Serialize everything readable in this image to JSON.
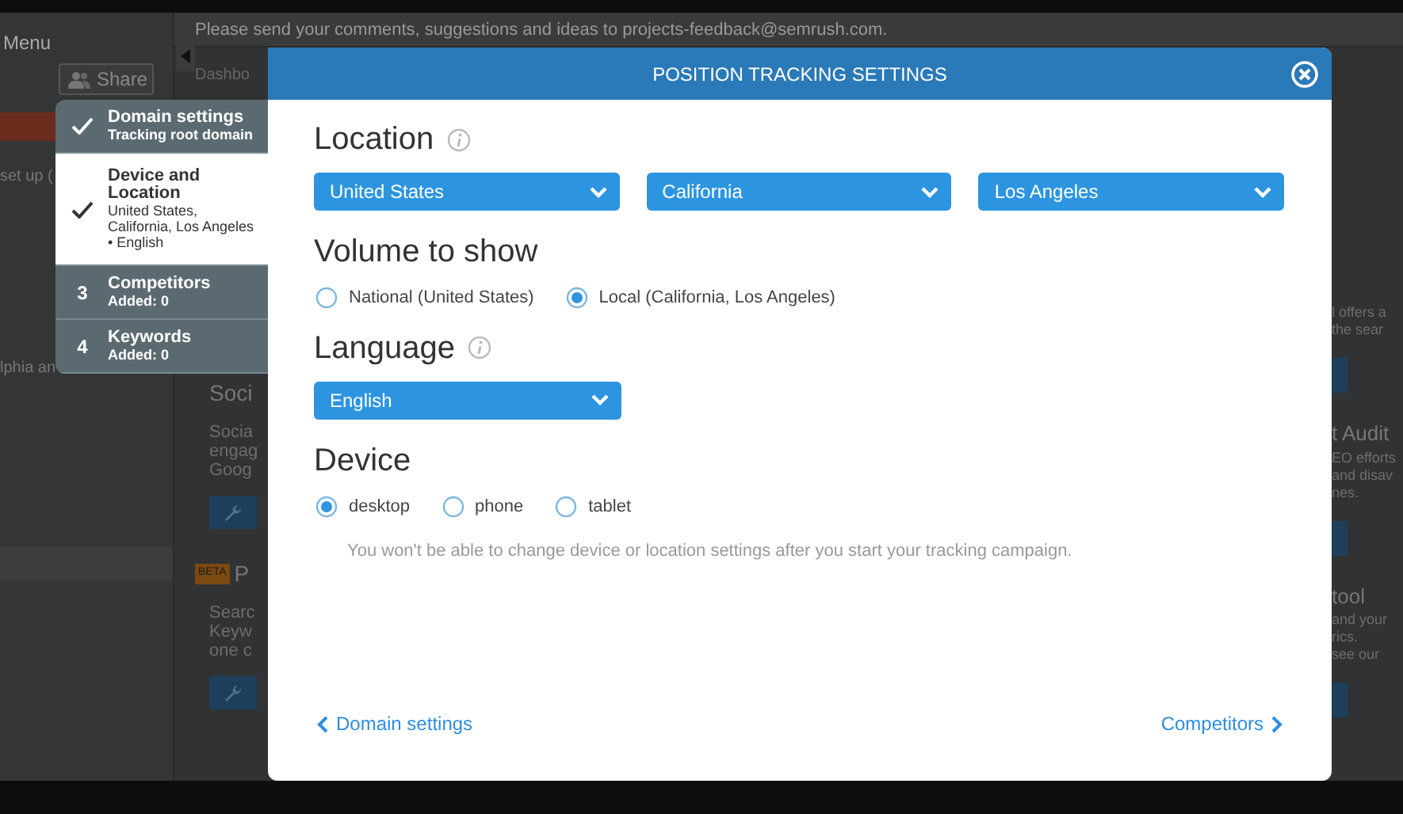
{
  "background": {
    "menu_label": "Menu",
    "share_button": "Share",
    "sidebar_texts": [
      "set up (",
      "lphia an"
    ],
    "notice": {
      "text": "Please send your comments, suggestions and ideas to",
      "link": "projects-feedback@semrush.com",
      "end": "."
    },
    "breadcrumb": "Dashbo",
    "left_cards": [
      {
        "title": "Soci",
        "lines": [
          "Socia",
          "engag",
          "Goog"
        ]
      },
      {
        "badge": "BETA",
        "title": "P",
        "lines": [
          "Searc",
          "Keyw",
          "one c"
        ]
      }
    ],
    "right_cards": [
      {
        "lines": [
          "l offers a",
          "the sear"
        ]
      },
      {
        "title": "t Audit",
        "lines": [
          "EO efforts",
          "and disav",
          "nes."
        ]
      },
      {
        "title": "tool",
        "lines": [
          "and your",
          "rics.",
          "see our"
        ]
      }
    ]
  },
  "steps": [
    {
      "done": true,
      "selected": false,
      "title": "Domain settings",
      "subtitle": "Tracking root domain"
    },
    {
      "done": true,
      "selected": true,
      "title": "Device and Location",
      "subtitle": "United States, California, Los Angeles • English"
    },
    {
      "done": false,
      "selected": false,
      "number": "3",
      "title": "Competitors",
      "subtitle": "Added: 0"
    },
    {
      "done": false,
      "selected": false,
      "number": "4",
      "title": "Keywords",
      "subtitle": "Added: 0"
    }
  ],
  "modal": {
    "title": "POSITION TRACKING SETTINGS",
    "sections": [
      {
        "kind": "selects",
        "heading": "Location",
        "info": true,
        "selects": [
          "United States",
          "California",
          "Los Angeles"
        ]
      },
      {
        "kind": "radios",
        "heading": "Volume to show",
        "options": [
          {
            "label": "National (United States)",
            "selected": false
          },
          {
            "label": "Local (California, Los Angeles)",
            "selected": true
          }
        ]
      },
      {
        "kind": "selects",
        "heading": "Language",
        "info": true,
        "selects": [
          "English"
        ]
      },
      {
        "kind": "radios",
        "heading": "Device",
        "options": [
          {
            "label": "desktop",
            "selected": true
          },
          {
            "label": "phone",
            "selected": false
          },
          {
            "label": "tablet",
            "selected": false
          }
        ]
      }
    ],
    "note": "You won't be able to change device or location settings after you start your tracking campaign.",
    "back_link": "Domain settings",
    "next_link": "Competitors"
  }
}
